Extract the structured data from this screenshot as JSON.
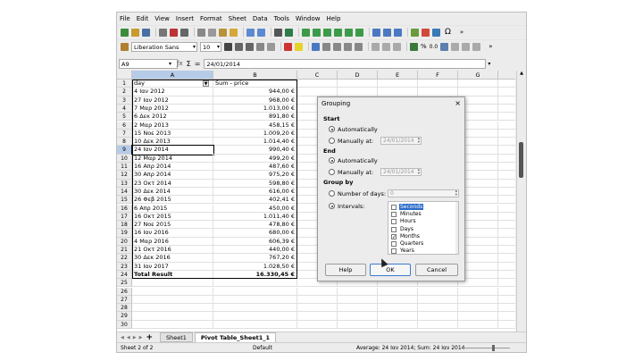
{
  "menu": [
    "File",
    "Edit",
    "View",
    "Insert",
    "Format",
    "Sheet",
    "Data",
    "Tools",
    "Window",
    "Help"
  ],
  "font": {
    "name": "Liberation Sans",
    "size": "10"
  },
  "formula": {
    "cell_ref": "A9",
    "value": "24/01/2014",
    "sum_sign": "Σ",
    "eq_sign": "="
  },
  "columns": [
    "A",
    "B",
    "C",
    "D",
    "E",
    "F",
    "G"
  ],
  "headers": {
    "day": "day",
    "sum": "Sum - price"
  },
  "rows": [
    {
      "n": "1",
      "a": "day",
      "b": "Sum - price"
    },
    {
      "n": "2",
      "a": "4 Ιαν 2012",
      "b": "944,00 €"
    },
    {
      "n": "3",
      "a": "27 Ιαν 2012",
      "b": "968,00 €"
    },
    {
      "n": "4",
      "a": "7 Μαρ 2012",
      "b": "1.013,00 €"
    },
    {
      "n": "5",
      "a": "6 Δεκ 2012",
      "b": "891,80 €"
    },
    {
      "n": "6",
      "a": "2 Μαρ 2013",
      "b": "458,15 €"
    },
    {
      "n": "7",
      "a": "15 Νοε 2013",
      "b": "1.009,20 €"
    },
    {
      "n": "8",
      "a": "10 Δεκ 2013",
      "b": "1.014,40 €"
    },
    {
      "n": "9",
      "a": "24 Ιαν 2014",
      "b": "990,40 €"
    },
    {
      "n": "10",
      "a": "12 Μαρ 2014",
      "b": "499,20 €"
    },
    {
      "n": "11",
      "a": "16 Απρ 2014",
      "b": "487,60 €"
    },
    {
      "n": "12",
      "a": "30 Απρ 2014",
      "b": "975,20 €"
    },
    {
      "n": "13",
      "a": "23 Οκτ 2014",
      "b": "598,80 €"
    },
    {
      "n": "14",
      "a": "30 Δεκ 2014",
      "b": "616,00 €"
    },
    {
      "n": "15",
      "a": "26 Φεβ 2015",
      "b": "402,41 €"
    },
    {
      "n": "16",
      "a": "6 Απρ 2015",
      "b": "450,00 €"
    },
    {
      "n": "17",
      "a": "16 Οκτ 2015",
      "b": "1.011,40 €"
    },
    {
      "n": "18",
      "a": "27 Νοε 2015",
      "b": "478,80 €"
    },
    {
      "n": "19",
      "a": "16 Ιαν 2016",
      "b": "680,00 €"
    },
    {
      "n": "20",
      "a": "4 Μαρ 2016",
      "b": "606,39 €"
    },
    {
      "n": "21",
      "a": "21 Οκτ 2016",
      "b": "440,00 €"
    },
    {
      "n": "22",
      "a": "30 Δεκ 2016",
      "b": "767,20 €"
    },
    {
      "n": "23",
      "a": "31 Ιαν 2017",
      "b": "1.028,50 €"
    },
    {
      "n": "24",
      "a": "Total Result",
      "b": "16.330,45 €"
    },
    {
      "n": "25",
      "a": "",
      "b": ""
    },
    {
      "n": "26",
      "a": "",
      "b": ""
    },
    {
      "n": "27",
      "a": "",
      "b": ""
    },
    {
      "n": "28",
      "a": "",
      "b": ""
    },
    {
      "n": "29",
      "a": "",
      "b": ""
    },
    {
      "n": "30",
      "a": "",
      "b": ""
    }
  ],
  "tabs": [
    "Sheet1",
    "Pivot Table_Sheet1_1"
  ],
  "status": {
    "sheet": "Sheet 2 of 2",
    "style": "Default",
    "summary": "Average: 24 Ιαν 2014; Sum: 24 Ιαν 2014"
  },
  "dialog": {
    "title": "Grouping",
    "start": "Start",
    "end": "End",
    "automatically": "Automatically",
    "manually": "Manually at:",
    "start_date": "24/01/2014",
    "end_date": "24/01/2014",
    "group_by": "Group by",
    "number_of_days": "Number of days:",
    "days_value": "0",
    "intervals": "Intervals:",
    "interval_items": [
      {
        "label": "Seconds",
        "checked": false
      },
      {
        "label": "Minutes",
        "checked": false
      },
      {
        "label": "Hours",
        "checked": false
      },
      {
        "label": "Days",
        "checked": false
      },
      {
        "label": "Months",
        "checked": true
      },
      {
        "label": "Quarters",
        "checked": false
      },
      {
        "label": "Years",
        "checked": false
      }
    ],
    "help": "Help",
    "ok": "OK",
    "cancel": "Cancel"
  },
  "colors": {
    "selection": "#2a6bc8",
    "header_active": "#b6cbe8"
  }
}
